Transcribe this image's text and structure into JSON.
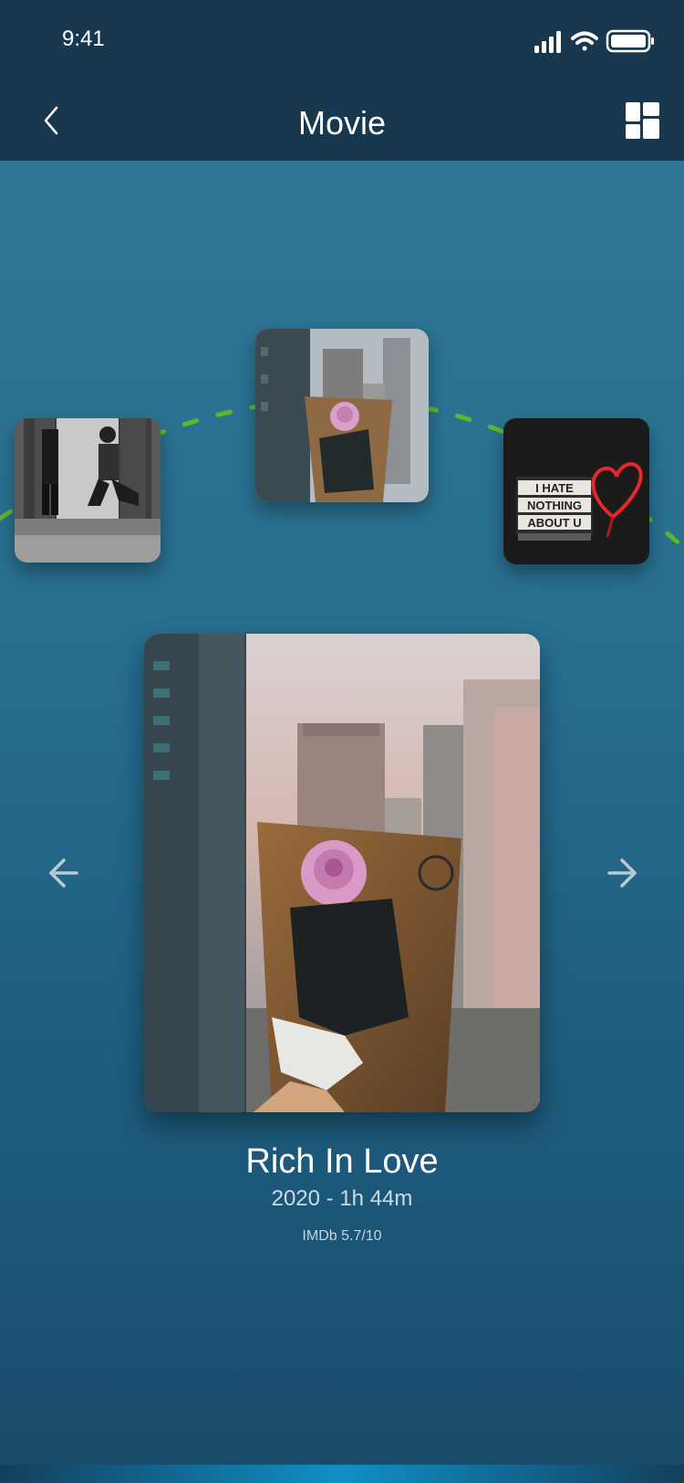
{
  "status_bar": {
    "time": "9:41",
    "icons": [
      "signal-icon",
      "wifi-icon",
      "battery-icon"
    ]
  },
  "header": {
    "title": "Movie",
    "back_icon": "chevron-left-icon",
    "view_toggle_icon": "grid-icon"
  },
  "carousel": {
    "thumbnails": [
      {
        "position": "left",
        "image": "couple-proposal-photo"
      },
      {
        "position": "center",
        "image": "rose-bouquet-city-photo",
        "selected": true
      },
      {
        "position": "right",
        "image": "neon-heart-lightbox-photo",
        "lightbox_text": [
          "I HATE",
          "NOTHING",
          "ABOUT U"
        ]
      }
    ]
  },
  "featured": {
    "title": "Rich In Love",
    "meta": "2020 - 1h 44m",
    "rating": "IMDb 5.7/10",
    "prev_icon": "arrow-left-icon",
    "next_icon": "arrow-right-icon"
  },
  "colors": {
    "header_bg": "#17384f",
    "background_top": "#2f7795",
    "background_bottom": "#1b4a69",
    "arc_dash": "#5fb52e",
    "text_primary": "#ffffff",
    "text_secondary": "#cfdbe4"
  }
}
